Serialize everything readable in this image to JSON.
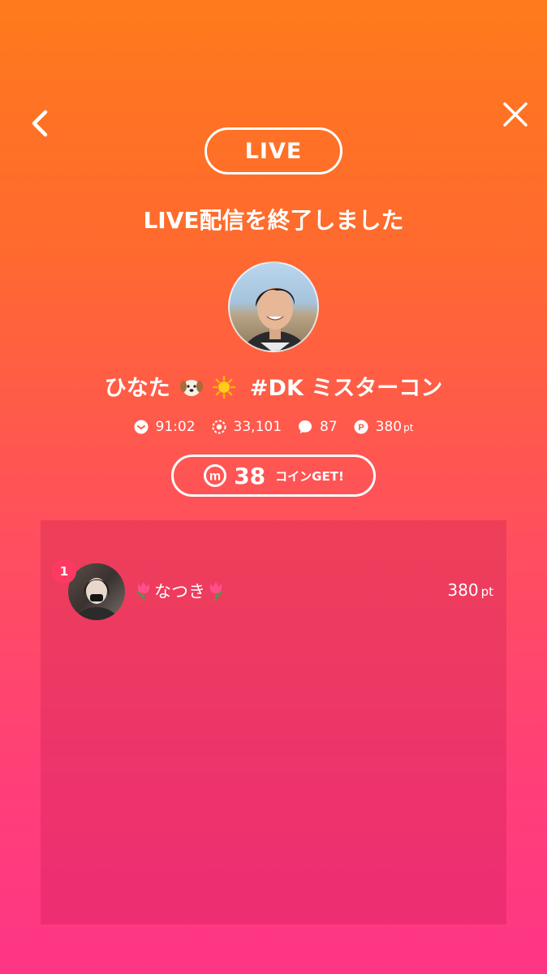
{
  "header": {
    "live_label": "LIVE",
    "end_title": "LIVE配信を終了しました"
  },
  "streamer": {
    "name_prefix": "ひなた",
    "name_suffix": "#DK ミスターコン"
  },
  "stats": {
    "duration": "91:02",
    "views": "33,101",
    "comments": "87",
    "points": "380",
    "points_unit": "pt"
  },
  "coins": {
    "count": "38",
    "label": "コインGET!",
    "icon": "m"
  },
  "ranking": [
    {
      "rank": "1",
      "name": "なつき",
      "points": "380",
      "unit": "pt"
    }
  ],
  "icons": [
    "back-icon",
    "close-icon",
    "clock-icon",
    "views-icon",
    "comment-icon",
    "points-icon",
    "coin-icon",
    "puppy-icon",
    "sun-icon",
    "tulip-icon"
  ]
}
